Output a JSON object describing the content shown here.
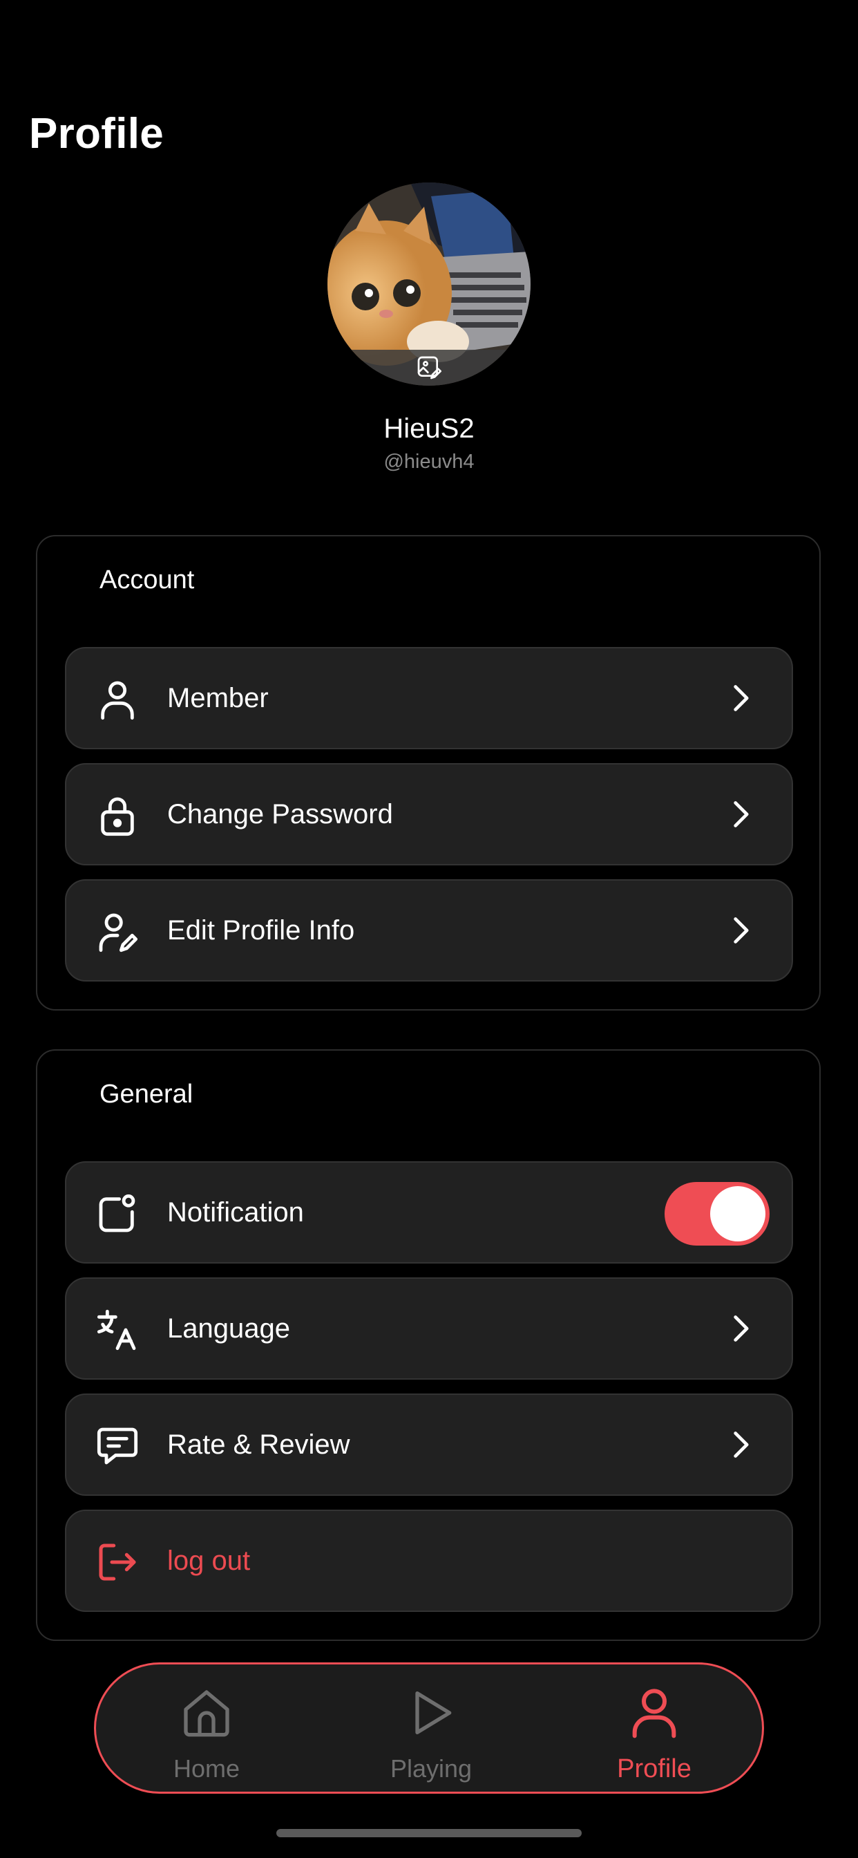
{
  "header": {
    "title": "Profile"
  },
  "profile": {
    "name": "HieuS2",
    "handle": "@hieuvh4",
    "avatar_icon": "edit-photo-icon"
  },
  "account": {
    "title": "Account",
    "items": [
      {
        "label": "Member",
        "icon": "user-icon"
      },
      {
        "label": "Change Password",
        "icon": "lock-icon"
      },
      {
        "label": "Edit Profile Info",
        "icon": "user-edit-icon"
      }
    ]
  },
  "general": {
    "title": "General",
    "items": [
      {
        "label": "Notification",
        "icon": "notification-icon",
        "toggle_on": true
      },
      {
        "label": "Language",
        "icon": "translate-icon"
      },
      {
        "label": "Rate & Review",
        "icon": "message-icon"
      },
      {
        "label": "log out",
        "icon": "logout-icon"
      }
    ]
  },
  "tabbar": {
    "tabs": [
      {
        "label": "Home",
        "icon": "home-icon"
      },
      {
        "label": "Playing",
        "icon": "play-icon"
      },
      {
        "label": "Profile",
        "icon": "profile-icon",
        "active": true
      }
    ]
  },
  "colors": {
    "accent": "#ef4d54",
    "background": "#000000",
    "row": "#212121"
  }
}
